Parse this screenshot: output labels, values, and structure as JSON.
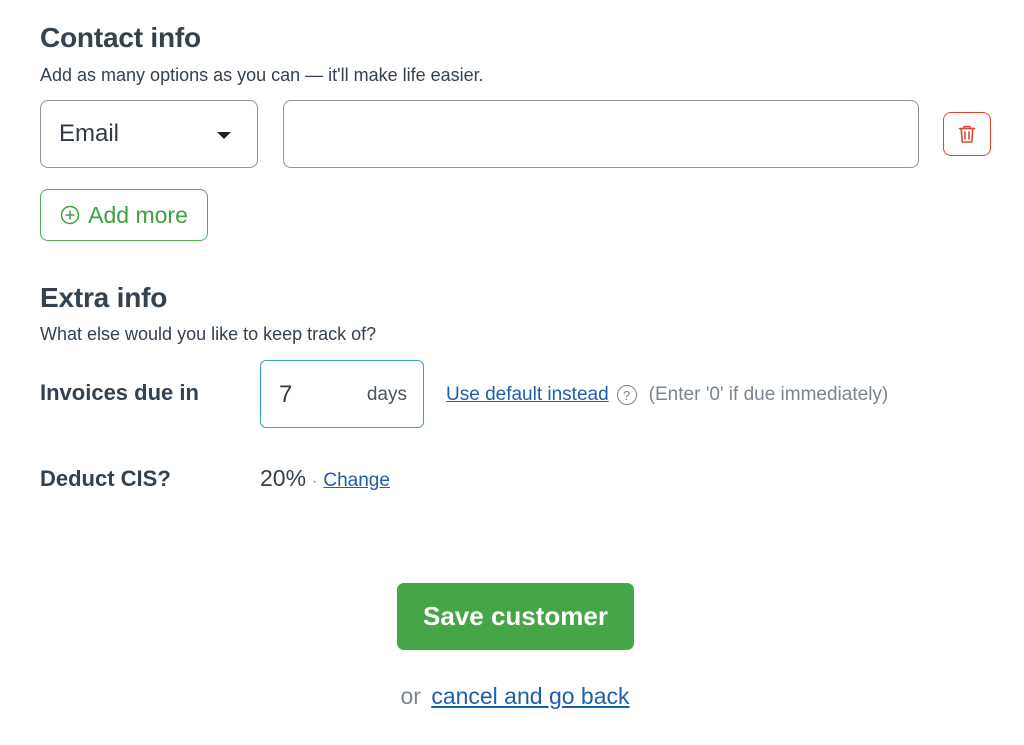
{
  "contact": {
    "title": "Contact info",
    "subtitle": "Add as many options as you can — it'll make life easier.",
    "type_select_value": "Email",
    "value_input": "",
    "add_more_label": "Add more"
  },
  "extra": {
    "title": "Extra info",
    "subtitle": "What else would you like to keep track of?",
    "invoices_label": "Invoices due in",
    "invoices_value": "7",
    "invoices_unit": "days",
    "use_default_link": "Use default instead",
    "help_glyph": "?",
    "hint": "(Enter '0' if due immediately)",
    "cis_label": "Deduct CIS?",
    "cis_value": "20%",
    "cis_separator": "·",
    "cis_change_link": "Change"
  },
  "actions": {
    "save_label": "Save customer",
    "or_text": "or",
    "cancel_link": "cancel and go back"
  },
  "colors": {
    "accent_green": "#46a547",
    "danger_red": "#e2452f",
    "link_blue": "#1d5fa8",
    "focus_blue": "#3b9ad9"
  },
  "icons": [
    "caret-down-icon",
    "trash-icon",
    "plus-circle-icon",
    "question-circle-icon"
  ]
}
